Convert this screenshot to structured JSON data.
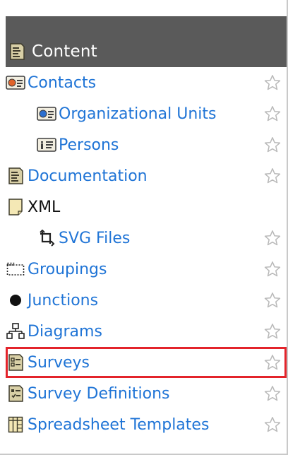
{
  "header": {
    "title": "Content",
    "icon": "document-icon"
  },
  "items": [
    {
      "label": "Contacts",
      "icon": "contact-card-icon",
      "favorite_icon": "star-outline-icon"
    },
    {
      "label": "Organizational Units",
      "icon": "org-unit-card-icon",
      "favorite_icon": "star-outline-icon"
    },
    {
      "label": "Persons",
      "icon": "person-card-icon",
      "favorite_icon": "star-outline-icon"
    },
    {
      "label": "Documentation",
      "icon": "document-icon",
      "favorite_icon": "star-outline-icon"
    },
    {
      "label": "XML",
      "icon": "page-icon"
    },
    {
      "label": "SVG Files",
      "icon": "svg-file-icon",
      "favorite_icon": "star-outline-icon"
    },
    {
      "label": "Groupings",
      "icon": "dashed-box-icon",
      "favorite_icon": "star-outline-icon"
    },
    {
      "label": "Junctions",
      "icon": "filled-circle-icon",
      "favorite_icon": "star-outline-icon"
    },
    {
      "label": "Diagrams",
      "icon": "hierarchy-icon",
      "favorite_icon": "star-outline-icon"
    },
    {
      "label": "Surveys",
      "icon": "survey-icon",
      "favorite_icon": "star-outline-icon",
      "selected": true
    },
    {
      "label": "Survey Definitions",
      "icon": "survey-definition-icon",
      "favorite_icon": "star-outline-icon"
    },
    {
      "label": "Spreadsheet Templates",
      "icon": "spreadsheet-template-icon",
      "favorite_icon": "star-outline-icon"
    }
  ],
  "colors": {
    "header_bg": "#5a5a5a",
    "link": "#1f74d6",
    "selection_border": "#e3242b",
    "star_outline": "#b9b9b9"
  }
}
